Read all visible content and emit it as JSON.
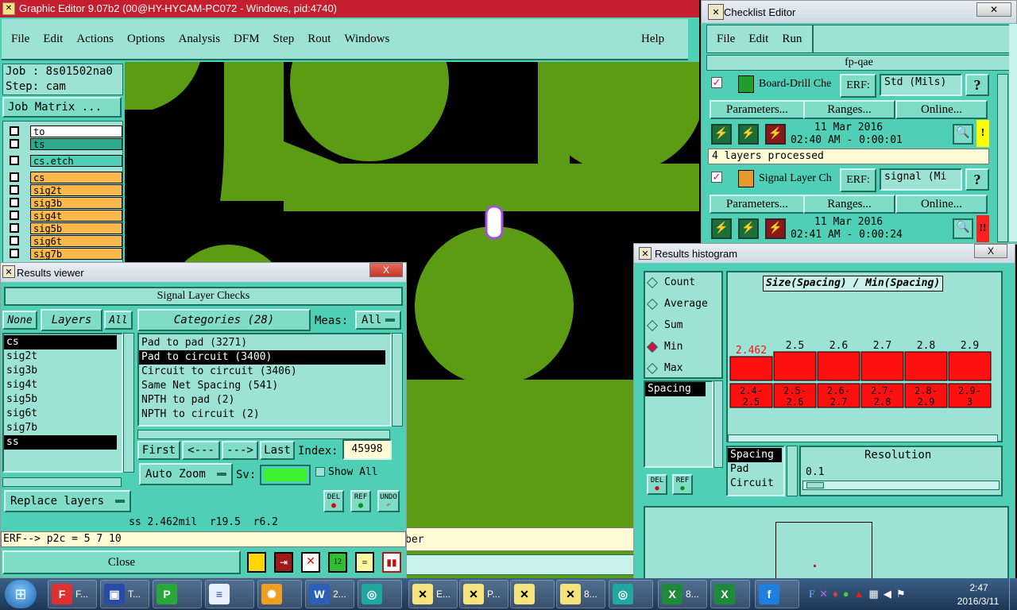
{
  "main": {
    "title": "Graphic Editor 9.07b2 (00@HY-HYCAM-PC072 - Windows, pid:4740)",
    "menu": [
      "File",
      "Edit",
      "Actions",
      "Options",
      "Analysis",
      "DFM",
      "Step",
      "Rout",
      "Windows"
    ],
    "help": "Help",
    "job": "Job : 8s01502na0",
    "step": "Step: cam",
    "job_matrix": "Job Matrix ...",
    "layers": [
      "to",
      "ts",
      "cs.etch",
      "cs",
      "sig2t",
      "sig3b",
      "sig4t",
      "sig5b",
      "sig6t",
      "sig7b"
    ],
    "bottom_fragment": "ber"
  },
  "checklist": {
    "title": "Checklist Editor",
    "menu": [
      "File",
      "Edit",
      "Run"
    ],
    "name": "fp-qae",
    "items": [
      {
        "name": "Board-Drill Che",
        "erf_label": "ERF:",
        "erf_value": "Std (Mils)",
        "help": "?",
        "params": "Parameters...",
        "ranges": "Ranges...",
        "online": "Online...",
        "date": "11 Mar 2016",
        "time": "02:40 AM - 0:00:01",
        "status": "!",
        "message": "4 layers processed",
        "status_color": "#ffff00"
      },
      {
        "name": "Signal Layer Ch",
        "erf_label": "ERF:",
        "erf_value": "signal (Mi",
        "help": "?",
        "params": "Parameters...",
        "ranges": "Ranges...",
        "online": "Online...",
        "date": "11 Mar 2016",
        "time": "02:41 AM - 0:00:24",
        "status": "!!",
        "status_color": "#ff1f1f"
      }
    ]
  },
  "viewer": {
    "title": "Results viewer",
    "close_x": "X",
    "header": "Signal Layer Checks",
    "none": "None",
    "layers_btn": "Layers",
    "all": "All",
    "categories_btn": "Categories (28)",
    "meas_label": "Meas:",
    "meas_value": "All",
    "layer_list": [
      "cs",
      "sig2t",
      "sig3b",
      "sig4t",
      "sig5b",
      "sig6t",
      "sig7b",
      "ss"
    ],
    "categories": [
      "Pad to pad (3271)",
      "Pad to circuit (3400)",
      "Circuit to circuit (3406)",
      "Same Net Spacing (541)",
      "NPTH to pad (2)",
      "NPTH to circuit (2)"
    ],
    "first": "First",
    "prev": "<---",
    "next": "--->",
    "last": "Last",
    "index_label": "Index:",
    "index_value": "45998",
    "auto_zoom": "Auto Zoom",
    "sv_label": "Sv:",
    "show_all": "Show All",
    "replace_layers": "Replace layers",
    "del": "DEL",
    "ref": "REF",
    "undo": "UNDO",
    "status_line": "ss 2.462mil  r19.5  r6.2",
    "erf_line": "ERF--> p2c = 5 7 10",
    "close": "Close"
  },
  "histogram": {
    "title": "Results histogram",
    "close_x": "X",
    "radios": [
      "Count",
      "Average",
      "Sum",
      "Min",
      "Max"
    ],
    "selected_radio": "Min",
    "metric_list": [
      "Spacing"
    ],
    "plot_title": "Size(Spacing) / Min(Spacing)",
    "del": "DEL",
    "ref": "REF",
    "bottom_list": [
      "Spacing",
      "Pad",
      "Circuit"
    ],
    "resolution_label": "Resolution",
    "resolution_value": "0.1",
    "accent": "#ff1010"
  },
  "chart_data": {
    "type": "bar",
    "title": "Size(Spacing) / Min(Spacing)",
    "top_labels": [
      "2.462",
      "2.5",
      "2.6",
      "2.7",
      "2.8",
      "2.9"
    ],
    "categories": [
      "2.4-2.5",
      "2.5-2.6",
      "2.6-2.7",
      "2.7-2.8",
      "2.8-2.9",
      "2.9-3"
    ],
    "values": [
      2.462,
      2.5,
      2.6,
      2.7,
      2.8,
      2.9
    ]
  },
  "taskbar": {
    "items": [
      "F...",
      "T...",
      "",
      "",
      "",
      "",
      "2...",
      "",
      "E...",
      "P...",
      "",
      "8...",
      "",
      "8...",
      ""
    ],
    "time": "2:47",
    "date": "2016/3/11"
  }
}
